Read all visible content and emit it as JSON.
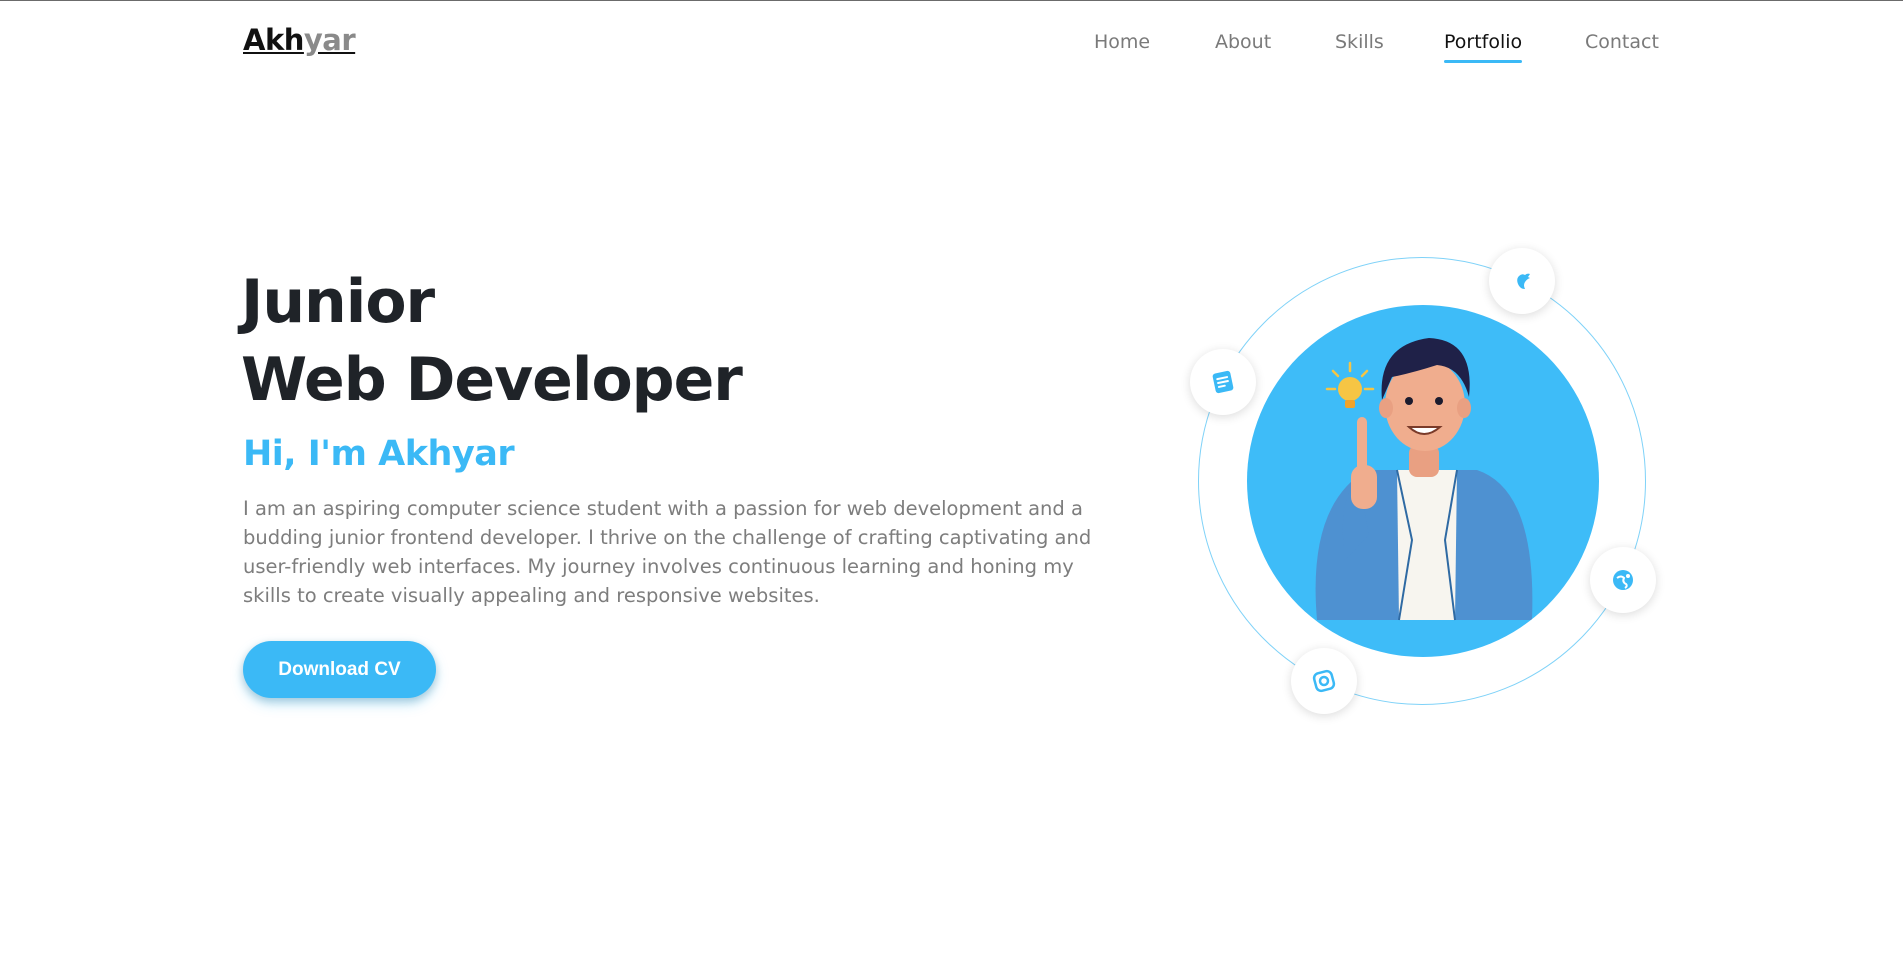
{
  "brand": {
    "part1": "Akh",
    "part2": "yar"
  },
  "nav": {
    "items": [
      {
        "label": "Home"
      },
      {
        "label": "About"
      },
      {
        "label": "Skills"
      },
      {
        "label": "Portfolio"
      },
      {
        "label": "Contact"
      }
    ],
    "active": "Portfolio"
  },
  "hero": {
    "title_line1": "Junior",
    "title_line2": "Web Developer",
    "greeting": "Hi, I'm Akhyar",
    "description": "I am an aspiring computer science student with a passion for web development and a budding junior frontend developer. I thrive on the challenge of crafting captivating and user-friendly web interfaces. My journey involves continuous learning and honing my skills to create visually appealing and responsive websites.",
    "cta_label": "Download CV"
  },
  "illustration": {
    "orbit_icons": [
      "blog-icon",
      "twitter-bird-icon",
      "globe-icon",
      "instagram-icon"
    ]
  },
  "colors": {
    "accent": "#3bb9f6",
    "heading": "#1f2328",
    "body_text": "#7d7d7d"
  }
}
